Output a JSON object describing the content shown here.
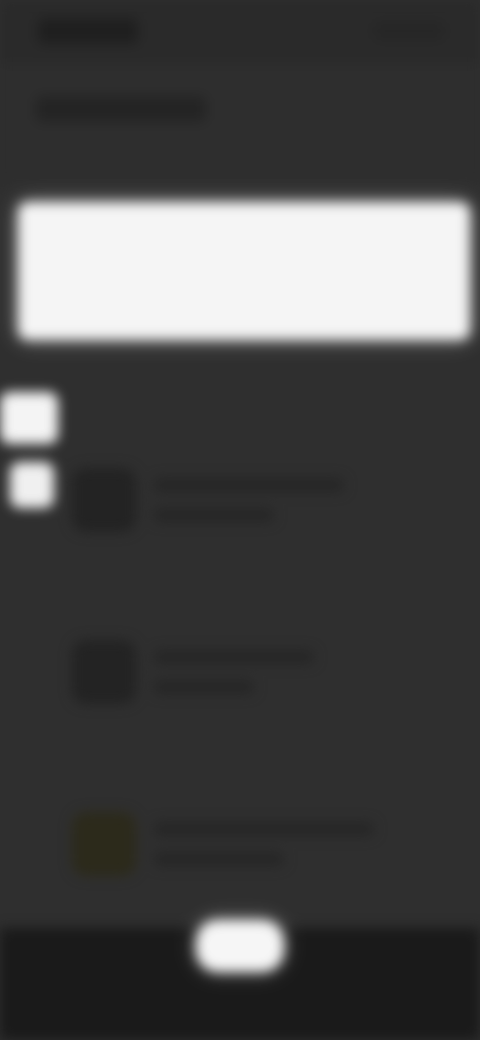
{
  "screen": {
    "status_bar": {
      "time_text": "",
      "icons": [
        "signal-icon",
        "battery-icon"
      ]
    },
    "header": {
      "title": ""
    },
    "hero_card": {
      "label": ""
    },
    "side_chips": [
      {
        "label": ""
      },
      {
        "label": ""
      }
    ],
    "list_items": [
      {
        "title": "",
        "subtitle": ""
      },
      {
        "title": "",
        "subtitle": ""
      },
      {
        "title": "",
        "subtitle": ""
      }
    ],
    "bottom_nav": {
      "home_label": ""
    },
    "colors": {
      "background": "#2f2f2f",
      "card": "#f5f5f5",
      "bottom_bar": "#1a1a1a"
    }
  }
}
